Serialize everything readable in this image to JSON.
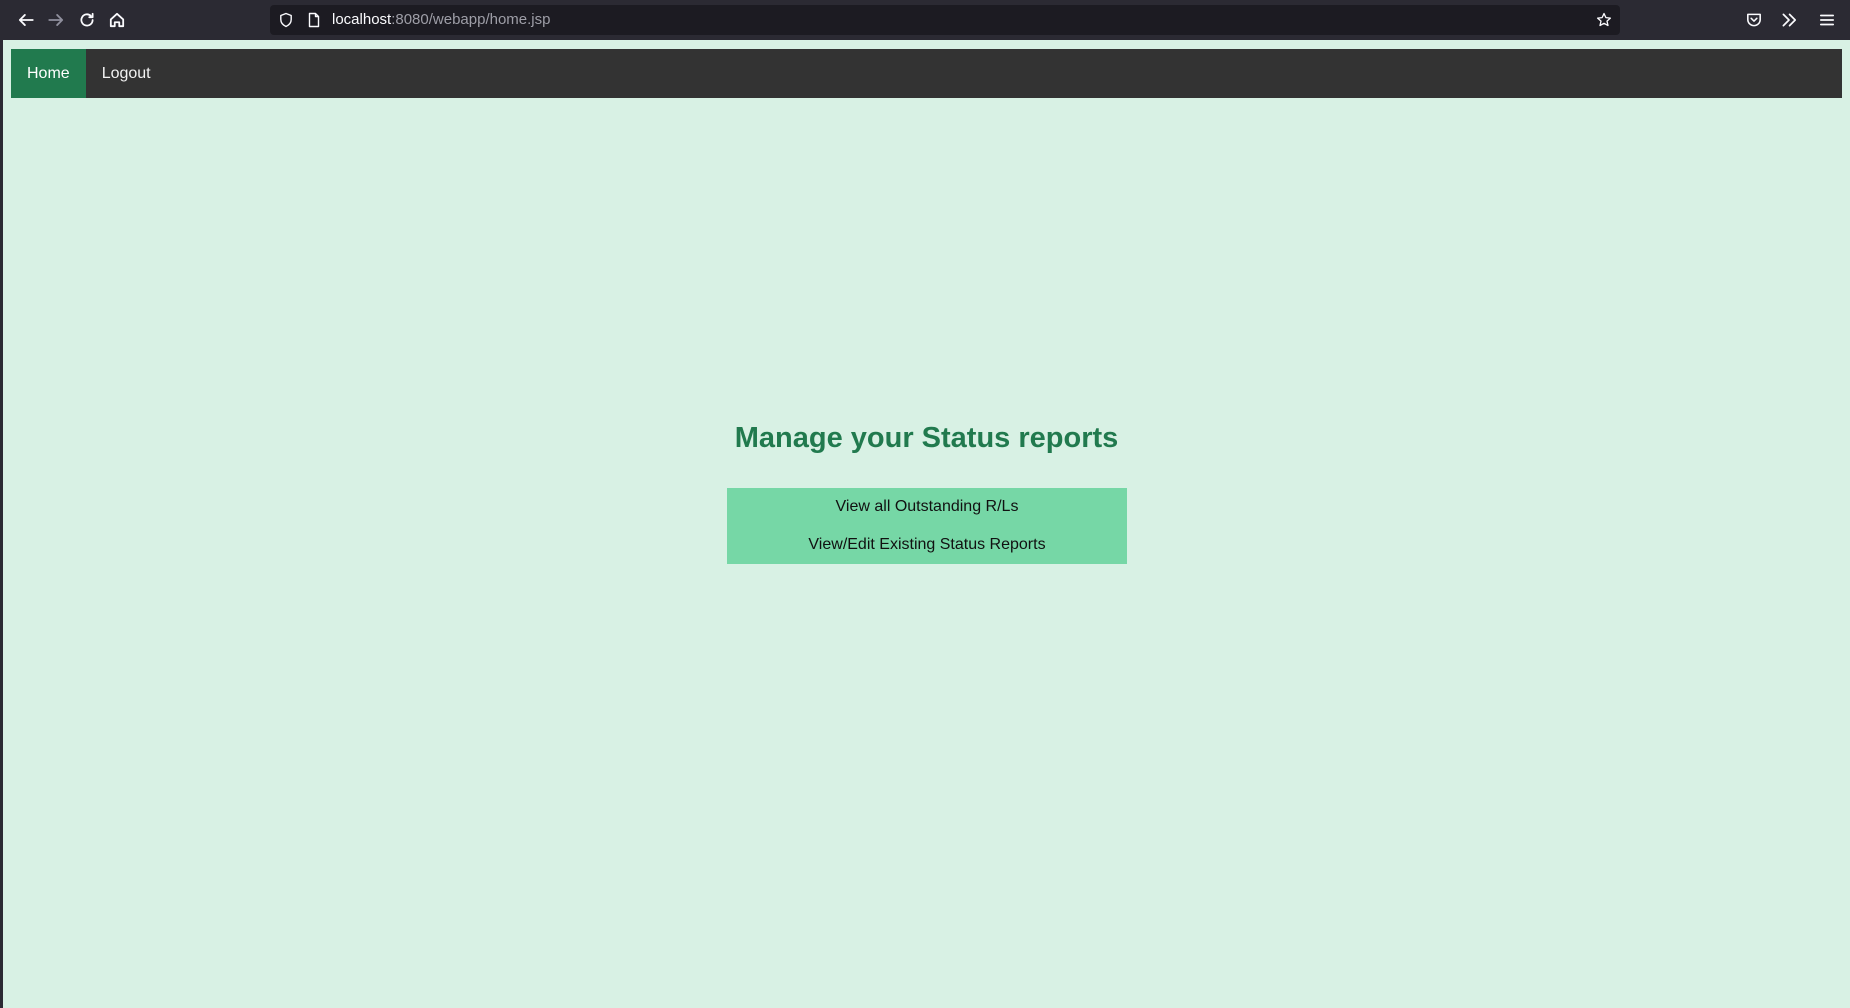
{
  "browser": {
    "url_host": "localhost",
    "url_rest": ":8080/webapp/home.jsp",
    "icons": {
      "back": "back-arrow-icon",
      "forward": "forward-arrow-icon",
      "reload": "reload-icon",
      "home": "home-icon",
      "tracking": "shield-icon",
      "page": "page-icon",
      "bookmark": "star-icon",
      "pocket": "pocket-icon",
      "extensions": "chevrons-right-icon",
      "menu": "hamburger-menu-icon"
    }
  },
  "nav": {
    "items": [
      {
        "label": "Home",
        "active": true
      },
      {
        "label": "Logout",
        "active": false
      }
    ]
  },
  "main": {
    "title": "Manage your Status reports",
    "buttons": [
      {
        "label": "View all Outstanding R/Ls"
      },
      {
        "label": "View/Edit Existing Status Reports"
      }
    ]
  },
  "colors": {
    "page_background": "#d8f1e4",
    "navbar_background": "#333333",
    "nav_active": "#217a4e",
    "title": "#217a4e",
    "button_panel": "#76d7a6"
  }
}
